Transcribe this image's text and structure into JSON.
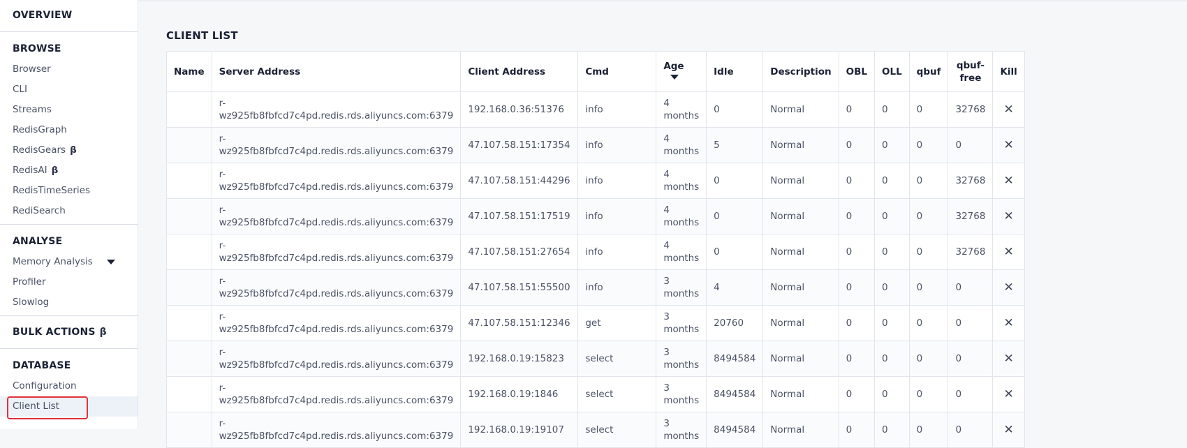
{
  "sidebar": {
    "overview": "OVERVIEW",
    "browse": {
      "title": "BROWSE",
      "items": [
        {
          "label": "Browser",
          "beta": ""
        },
        {
          "label": "CLI",
          "beta": ""
        },
        {
          "label": "Streams",
          "beta": ""
        },
        {
          "label": "RedisGraph",
          "beta": ""
        },
        {
          "label": "RedisGears",
          "beta": "β"
        },
        {
          "label": "RedisAI",
          "beta": "β"
        },
        {
          "label": "RedisTimeSeries",
          "beta": ""
        },
        {
          "label": "RediSearch",
          "beta": ""
        }
      ]
    },
    "analyse": {
      "title": "ANALYSE",
      "items": [
        {
          "label": "Memory Analysis"
        },
        {
          "label": "Profiler"
        },
        {
          "label": "Slowlog"
        }
      ]
    },
    "bulk_actions": {
      "title": "BULK ACTIONS",
      "beta": "β"
    },
    "database": {
      "title": "DATABASE",
      "items": [
        {
          "label": "Configuration"
        },
        {
          "label": "Client List"
        }
      ]
    },
    "highlight_color": "#e0313a"
  },
  "main": {
    "title": "CLIENT LIST",
    "columns": [
      "Name",
      "Server Address",
      "Client Address",
      "Cmd",
      "Age",
      "Idle",
      "Description",
      "OBL",
      "OLL",
      "qbuf",
      "qbuf-free",
      "Kill"
    ],
    "sorted_column": "Age",
    "kill_icon": "✕",
    "rows": [
      {
        "name": "",
        "server": "r-wz925fb8fbfcd7c4pd.redis.rds.aliyuncs.com:6379",
        "client": "192.168.0.36:51376",
        "cmd": "info",
        "age": "4 months",
        "idle": "0",
        "desc": "Normal",
        "obl": "0",
        "oll": "0",
        "qbuf": "0",
        "qbuf_free": "32768"
      },
      {
        "name": "",
        "server": "r-wz925fb8fbfcd7c4pd.redis.rds.aliyuncs.com:6379",
        "client": "47.107.58.151:17354",
        "cmd": "info",
        "age": "4 months",
        "idle": "5",
        "desc": "Normal",
        "obl": "0",
        "oll": "0",
        "qbuf": "0",
        "qbuf_free": "0"
      },
      {
        "name": "",
        "server": "r-wz925fb8fbfcd7c4pd.redis.rds.aliyuncs.com:6379",
        "client": "47.107.58.151:44296",
        "cmd": "info",
        "age": "4 months",
        "idle": "0",
        "desc": "Normal",
        "obl": "0",
        "oll": "0",
        "qbuf": "0",
        "qbuf_free": "32768"
      },
      {
        "name": "",
        "server": "r-wz925fb8fbfcd7c4pd.redis.rds.aliyuncs.com:6379",
        "client": "47.107.58.151:17519",
        "cmd": "info",
        "age": "4 months",
        "idle": "0",
        "desc": "Normal",
        "obl": "0",
        "oll": "0",
        "qbuf": "0",
        "qbuf_free": "32768"
      },
      {
        "name": "",
        "server": "r-wz925fb8fbfcd7c4pd.redis.rds.aliyuncs.com:6379",
        "client": "47.107.58.151:27654",
        "cmd": "info",
        "age": "4 months",
        "idle": "0",
        "desc": "Normal",
        "obl": "0",
        "oll": "0",
        "qbuf": "0",
        "qbuf_free": "32768"
      },
      {
        "name": "",
        "server": "r-wz925fb8fbfcd7c4pd.redis.rds.aliyuncs.com:6379",
        "client": "47.107.58.151:55500",
        "cmd": "info",
        "age": "3 months",
        "idle": "4",
        "desc": "Normal",
        "obl": "0",
        "oll": "0",
        "qbuf": "0",
        "qbuf_free": "0"
      },
      {
        "name": "",
        "server": "r-wz925fb8fbfcd7c4pd.redis.rds.aliyuncs.com:6379",
        "client": "47.107.58.151:12346",
        "cmd": "get",
        "age": "3 months",
        "idle": "20760",
        "desc": "Normal",
        "obl": "0",
        "oll": "0",
        "qbuf": "0",
        "qbuf_free": "0"
      },
      {
        "name": "",
        "server": "r-wz925fb8fbfcd7c4pd.redis.rds.aliyuncs.com:6379",
        "client": "192.168.0.19:15823",
        "cmd": "select",
        "age": "3 months",
        "idle": "8494584",
        "desc": "Normal",
        "obl": "0",
        "oll": "0",
        "qbuf": "0",
        "qbuf_free": "0"
      },
      {
        "name": "",
        "server": "r-wz925fb8fbfcd7c4pd.redis.rds.aliyuncs.com:6379",
        "client": "192.168.0.19:1846",
        "cmd": "select",
        "age": "3 months",
        "idle": "8494584",
        "desc": "Normal",
        "obl": "0",
        "oll": "0",
        "qbuf": "0",
        "qbuf_free": "0"
      },
      {
        "name": "",
        "server": "r-wz925fb8fbfcd7c4pd.redis.rds.aliyuncs.com:6379",
        "client": "192.168.0.19:19107",
        "cmd": "select",
        "age": "3 months",
        "idle": "8494584",
        "desc": "Normal",
        "obl": "0",
        "oll": "0",
        "qbuf": "0",
        "qbuf_free": "0"
      }
    ]
  }
}
